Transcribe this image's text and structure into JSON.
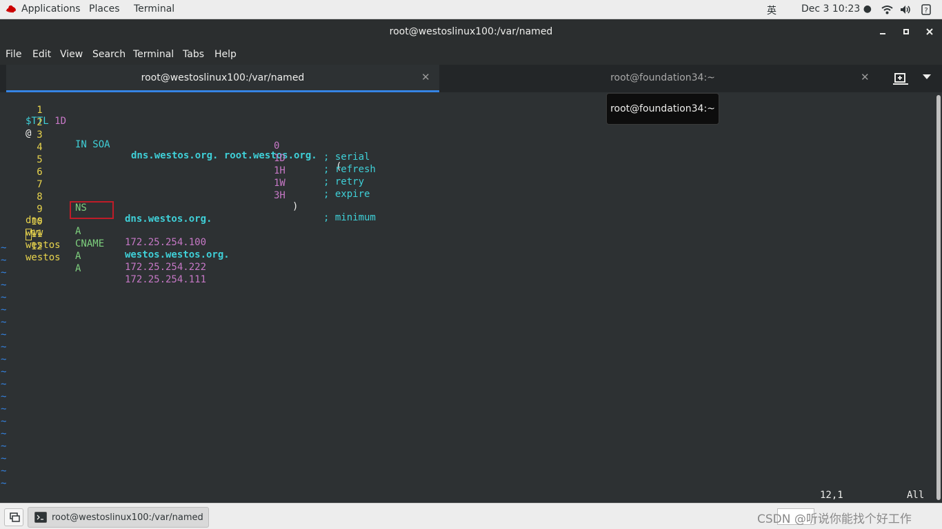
{
  "topbar": {
    "applications": "Applications",
    "places": "Places",
    "terminal": "Terminal",
    "input_method": "英",
    "clock": "Dec 3  10:23 ●",
    "icons": [
      "wifi-icon",
      "volume-icon",
      "help-icon"
    ]
  },
  "window": {
    "title": "root@westoslinux100:/var/named"
  },
  "menu": [
    "File",
    "Edit",
    "View",
    "Search",
    "Terminal",
    "Tabs",
    "Help"
  ],
  "tabs": [
    {
      "label": "root@westoslinux100:/var/named",
      "active": true
    },
    {
      "label": "root@foundation34:~",
      "active": false
    }
  ],
  "tooltip": "root@foundation34:~",
  "editor": {
    "lines": [
      {
        "n": "1",
        "c1": "$TTL 1D"
      },
      {
        "n": "2",
        "c1": "@",
        "c2": "IN SOA",
        "c3": "dns.westos.org. root.westos.org.",
        "c4": "("
      },
      {
        "n": "3",
        "val": "0",
        "comment": "; serial"
      },
      {
        "n": "4",
        "val": "1D",
        "comment": "; refresh"
      },
      {
        "n": "5",
        "val": "1H",
        "comment": "; retry"
      },
      {
        "n": "6",
        "val": "1W",
        "comment": "; expire"
      },
      {
        "n": "7",
        "val": "3H",
        "paren": ")",
        "comment": "; minimum"
      },
      {
        "n": "8",
        "c2": "NS",
        "c3": "dns.westos.org."
      },
      {
        "n": "9",
        "c1": "dns",
        "c2": "A",
        "c3": "172.25.254.100"
      },
      {
        "n": "10",
        "c1": "www",
        "c2": "CNAME",
        "c3": "westos.westos.org."
      },
      {
        "n": "11",
        "c1": "westos",
        "c2": "A",
        "c3": "172.25.254.222"
      },
      {
        "n": "12",
        "c1": "westos",
        "c2": "A",
        "c3": "172.25.254.111"
      }
    ],
    "tilde": "~",
    "status_position": "12,1",
    "status_scroll": "All"
  },
  "taskbar": {
    "window_label": "root@westoslinux100:/var/named",
    "watermark": "CSDN @听说你能找个好工作"
  },
  "colors": {
    "accent": "#3584e4",
    "highlight_box": "#c01c28",
    "line_number": "#e8d44d"
  }
}
